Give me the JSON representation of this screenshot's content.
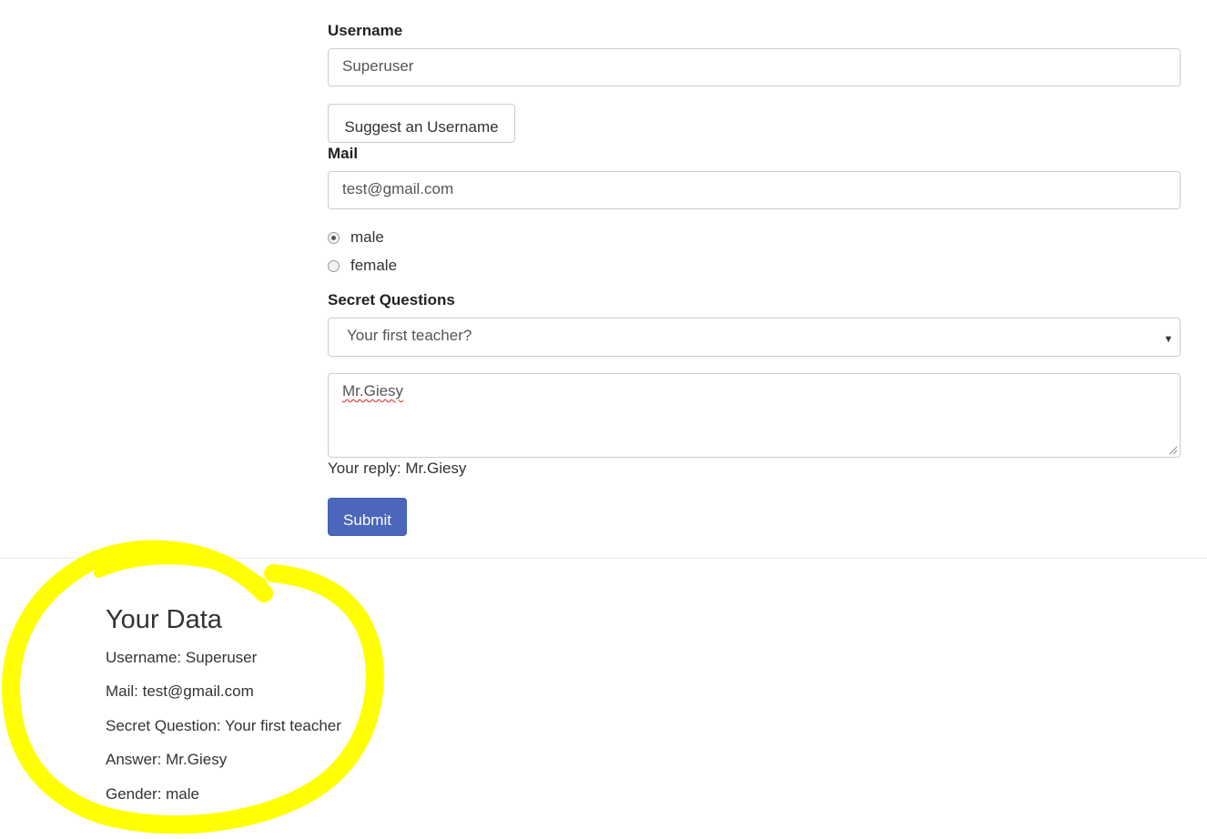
{
  "form": {
    "username_label": "Username",
    "username_value": "Superuser",
    "suggest_button": "Suggest an Username",
    "mail_label": "Mail",
    "mail_value": "test@gmail.com",
    "gender_options": [
      {
        "label": "male",
        "checked": true
      },
      {
        "label": "female",
        "checked": false
      }
    ],
    "secret_label": "Secret Questions",
    "secret_selected": "Your first teacher?",
    "answer_value": "Mr.Giesy",
    "reply_text": "Your reply: Mr.Giesy",
    "submit_button": "Submit"
  },
  "your_data": {
    "title": "Your Data",
    "lines": [
      "Username: Superuser",
      "Mail: test@gmail.com",
      "Secret Question: Your first teacher",
      "Answer: Mr.Giesy",
      "Gender: male"
    ]
  },
  "colors": {
    "primary": "#4b66ba",
    "highlight": "#ffff00",
    "spellcheck": "#e02020"
  }
}
